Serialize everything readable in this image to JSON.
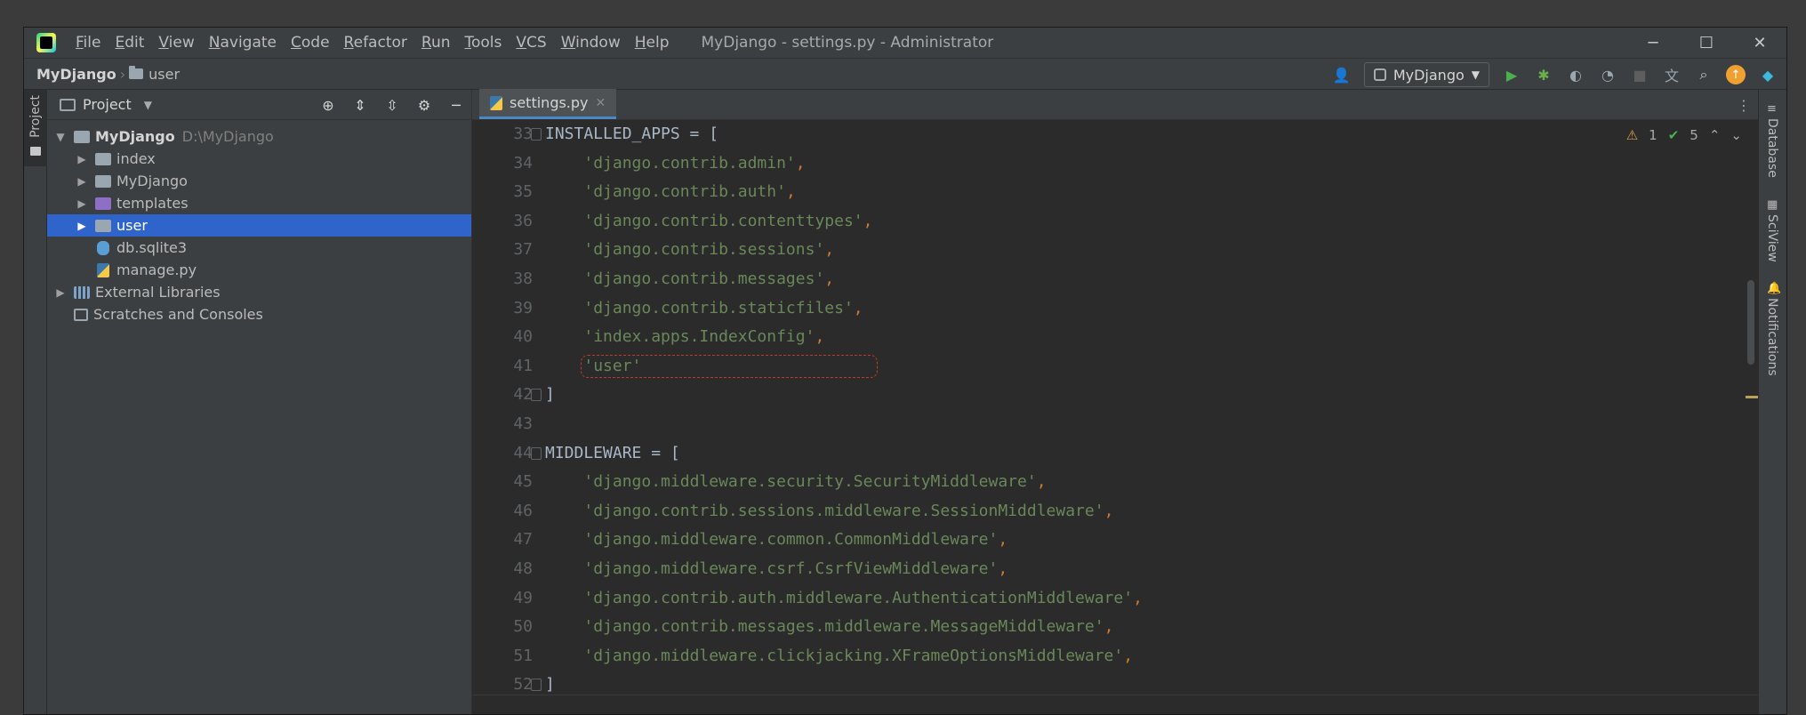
{
  "titlebar": {
    "menu": [
      {
        "mnemonic": "F",
        "rest": "ile"
      },
      {
        "mnemonic": "E",
        "rest": "dit"
      },
      {
        "mnemonic": "V",
        "rest": "iew"
      },
      {
        "mnemonic": "N",
        "rest": "avigate"
      },
      {
        "mnemonic": "C",
        "rest": "ode"
      },
      {
        "mnemonic": "R",
        "rest": "efactor"
      },
      {
        "mnemonic": "R",
        "rest": "un"
      },
      {
        "mnemonic": "T",
        "rest": "ools"
      },
      {
        "mnemonic": "V",
        "rest": "CS"
      },
      {
        "mnemonic": "W",
        "rest": "indow"
      },
      {
        "mnemonic": "H",
        "rest": "elp"
      }
    ],
    "window_title": "MyDjango - settings.py - Administrator",
    "minimize": "─",
    "maximize": "☐",
    "close": "✕"
  },
  "navbar": {
    "project": "MyDjango",
    "folder": "user",
    "run_config": "MyDjango"
  },
  "left_strip": {
    "project_tab": "Project"
  },
  "project_panel": {
    "title": "Project",
    "tree": {
      "root": {
        "name": "MyDjango",
        "path": "D:\\MyDjango"
      },
      "index": "index",
      "mydjango": "MyDjango",
      "templates": "templates",
      "user": "user",
      "db": "db.sqlite3",
      "manage": "manage.py",
      "external": "External Libraries",
      "scratches": "Scratches and Consoles"
    }
  },
  "editor": {
    "tab": "settings.py",
    "inspections": {
      "warnings": "1",
      "ok": "5"
    },
    "lines": [
      {
        "n": "33",
        "segs": [
          {
            "t": "INSTALLED_APPS = [",
            "c": ""
          }
        ]
      },
      {
        "n": "34",
        "segs": [
          {
            "t": "    ",
            "c": ""
          },
          {
            "t": "'django.contrib.admin'",
            "c": "s"
          },
          {
            "t": ",",
            "c": "p"
          }
        ]
      },
      {
        "n": "35",
        "segs": [
          {
            "t": "    ",
            "c": ""
          },
          {
            "t": "'django.contrib.auth'",
            "c": "s"
          },
          {
            "t": ",",
            "c": "p"
          }
        ]
      },
      {
        "n": "36",
        "segs": [
          {
            "t": "    ",
            "c": ""
          },
          {
            "t": "'django.contrib.contenttypes'",
            "c": "s"
          },
          {
            "t": ",",
            "c": "p"
          }
        ]
      },
      {
        "n": "37",
        "segs": [
          {
            "t": "    ",
            "c": ""
          },
          {
            "t": "'django.contrib.sessions'",
            "c": "s"
          },
          {
            "t": ",",
            "c": "p"
          }
        ]
      },
      {
        "n": "38",
        "segs": [
          {
            "t": "    ",
            "c": ""
          },
          {
            "t": "'django.contrib.messages'",
            "c": "s"
          },
          {
            "t": ",",
            "c": "p"
          }
        ]
      },
      {
        "n": "39",
        "segs": [
          {
            "t": "    ",
            "c": ""
          },
          {
            "t": "'django.contrib.staticfiles'",
            "c": "s"
          },
          {
            "t": ",",
            "c": "p"
          }
        ]
      },
      {
        "n": "40",
        "segs": [
          {
            "t": "    ",
            "c": ""
          },
          {
            "t": "'index.apps.IndexConfig'",
            "c": "s"
          },
          {
            "t": ",",
            "c": "p"
          }
        ]
      },
      {
        "n": "41",
        "segs": [
          {
            "t": "    ",
            "c": ""
          },
          {
            "t": "'user'",
            "c": "s"
          }
        ],
        "highlight": true
      },
      {
        "n": "42",
        "segs": [
          {
            "t": "]",
            "c": ""
          }
        ]
      },
      {
        "n": "43",
        "segs": [
          {
            "t": "",
            "c": ""
          }
        ]
      },
      {
        "n": "44",
        "segs": [
          {
            "t": "MIDDLEWARE = [",
            "c": ""
          }
        ]
      },
      {
        "n": "45",
        "segs": [
          {
            "t": "    ",
            "c": ""
          },
          {
            "t": "'django.middleware.security.SecurityMiddleware'",
            "c": "s"
          },
          {
            "t": ",",
            "c": "p"
          }
        ]
      },
      {
        "n": "46",
        "segs": [
          {
            "t": "    ",
            "c": ""
          },
          {
            "t": "'django.contrib.sessions.middleware.SessionMiddleware'",
            "c": "s"
          },
          {
            "t": ",",
            "c": "p"
          }
        ]
      },
      {
        "n": "47",
        "segs": [
          {
            "t": "    ",
            "c": ""
          },
          {
            "t": "'django.middleware.common.CommonMiddleware'",
            "c": "s"
          },
          {
            "t": ",",
            "c": "p"
          }
        ]
      },
      {
        "n": "48",
        "segs": [
          {
            "t": "    ",
            "c": ""
          },
          {
            "t": "'django.middleware.csrf.CsrfViewMiddleware'",
            "c": "s"
          },
          {
            "t": ",",
            "c": "p"
          }
        ]
      },
      {
        "n": "49",
        "segs": [
          {
            "t": "    ",
            "c": ""
          },
          {
            "t": "'django.contrib.auth.middleware.AuthenticationMiddleware'",
            "c": "s"
          },
          {
            "t": ",",
            "c": "p"
          }
        ]
      },
      {
        "n": "50",
        "segs": [
          {
            "t": "    ",
            "c": ""
          },
          {
            "t": "'django.contrib.messages.middleware.MessageMiddleware'",
            "c": "s"
          },
          {
            "t": ",",
            "c": "p"
          }
        ]
      },
      {
        "n": "51",
        "segs": [
          {
            "t": "    ",
            "c": ""
          },
          {
            "t": "'django.middleware.clickjacking.XFrameOptionsMiddleware'",
            "c": "s"
          },
          {
            "t": ",",
            "c": "p"
          }
        ]
      },
      {
        "n": "52",
        "segs": [
          {
            "t": "]",
            "c": ""
          }
        ]
      }
    ]
  },
  "right_strip": {
    "database": "Database",
    "sciview": "SciView",
    "notifications": "Notifications"
  },
  "colors": {
    "selection": "#2f65ca",
    "string": "#6a8759",
    "punct": "#cc7832",
    "highlight_border": "#c0392b"
  }
}
